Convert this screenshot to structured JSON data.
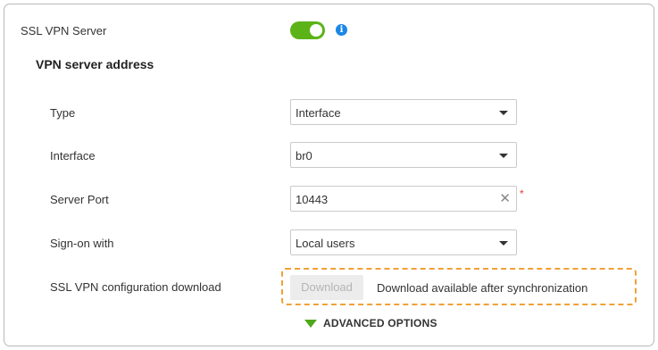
{
  "ssl_vpn_server": {
    "label": "SSL VPN Server",
    "enabled": true,
    "info_icon": "i"
  },
  "section": {
    "title": "VPN server address"
  },
  "fields": {
    "type": {
      "label": "Type",
      "value": "Interface"
    },
    "interface": {
      "label": "Interface",
      "value": "br0"
    },
    "server_port": {
      "label": "Server Port",
      "value": "10443",
      "required_mark": "*"
    },
    "sign_on": {
      "label": "Sign-on with",
      "value": "Local users"
    }
  },
  "config_download": {
    "label": "SSL VPN configuration download",
    "button_label": "Download",
    "status_text": "Download available after synchronization"
  },
  "advanced": {
    "label": "ADVANCED OPTIONS"
  },
  "colors": {
    "accent_green": "#5cb318",
    "info_blue": "#1a87e6",
    "highlight_orange": "#f0a136",
    "required_red": "#e53935"
  }
}
